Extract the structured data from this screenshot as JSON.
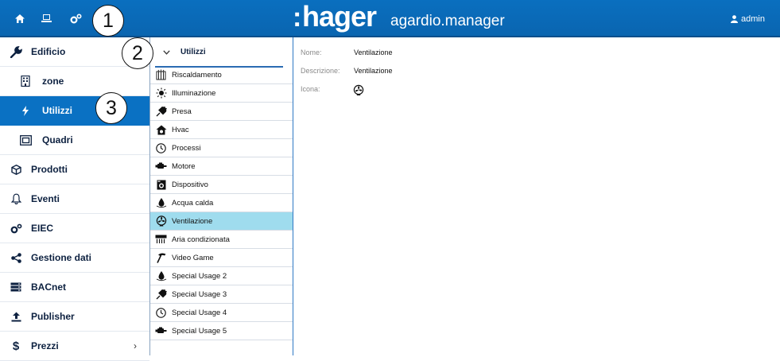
{
  "topbar": {
    "brand": "hager",
    "app_name": "agardio.manager",
    "user": "admin",
    "icons": [
      "home-icon",
      "monitor-icon",
      "settings-gears-icon"
    ]
  },
  "callouts": [
    "1",
    "2",
    "3"
  ],
  "sidebar": {
    "items": [
      {
        "label": "Edificio",
        "icon": "wrench-icon"
      },
      {
        "label": "zone",
        "icon": "building-icon"
      },
      {
        "label": "Utilizzi",
        "icon": "bolt-icon",
        "active": true
      },
      {
        "label": "Quadri",
        "icon": "panel-icon"
      },
      {
        "label": "Prodotti",
        "icon": "box-icon"
      },
      {
        "label": "Eventi",
        "icon": "bell-icon"
      },
      {
        "label": "EIEC",
        "icon": "gears-icon"
      },
      {
        "label": "Gestione dati",
        "icon": "share-icon"
      },
      {
        "label": "BACnet",
        "icon": "server-icon"
      },
      {
        "label": "Publisher",
        "icon": "upload-icon"
      },
      {
        "label": "Prezzi",
        "icon": "dollar-icon",
        "chevron": "›"
      }
    ]
  },
  "usage_list": {
    "title": "Utilizzi",
    "items": [
      {
        "label": "Riscaldamento",
        "icon": "radiator-icon"
      },
      {
        "label": "Illuminazione",
        "icon": "lightbulb-icon"
      },
      {
        "label": "Presa",
        "icon": "plug-icon"
      },
      {
        "label": "Hvac",
        "icon": "house-icon"
      },
      {
        "label": "Processi",
        "icon": "clock-icon"
      },
      {
        "label": "Motore",
        "icon": "motor-icon"
      },
      {
        "label": "Dispositivo",
        "icon": "washing-machine-icon"
      },
      {
        "label": "Acqua calda",
        "icon": "water-drop-icon"
      },
      {
        "label": "Ventilazione",
        "icon": "fan-icon",
        "selected": true
      },
      {
        "label": "Aria condizionata",
        "icon": "air-conditioner-icon"
      },
      {
        "label": "Video Game",
        "icon": "hammer-icon"
      },
      {
        "label": "Special Usage 2",
        "icon": "water-drop-icon"
      },
      {
        "label": "Special Usage 3",
        "icon": "plug-icon"
      },
      {
        "label": "Special Usage 4",
        "icon": "clock-icon"
      },
      {
        "label": "Special Usage 5",
        "icon": "motor-icon"
      }
    ]
  },
  "detail": {
    "name_label": "Nome:",
    "name_value": "Ventilazione",
    "description_label": "Descrizione:",
    "description_value": "Ventilazione",
    "icon_label": "Icona:",
    "icon_value": "fan-icon"
  },
  "colors": {
    "topbar": "#0a6fbf",
    "active_nav": "#0a71c3",
    "selected_row": "#9fdcee",
    "nav_text": "#0d2140"
  }
}
